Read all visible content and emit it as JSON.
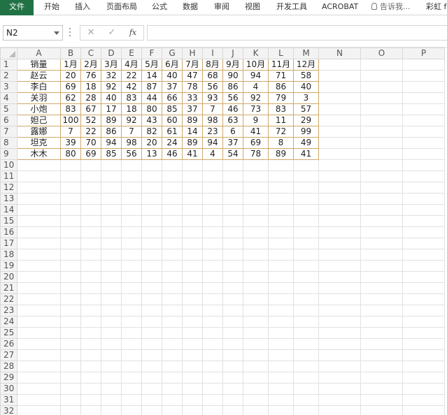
{
  "ribbon": {
    "tabs": [
      "文件",
      "开始",
      "插入",
      "页面布局",
      "公式",
      "数据",
      "审阅",
      "视图",
      "开发工具",
      "ACROBAT"
    ],
    "tell_me": "告诉我...",
    "user": "彩虹 f"
  },
  "formula_bar": {
    "name_box": "N2",
    "cancel_symbol": "✕",
    "enter_symbol": "✓",
    "fx_label": "fx",
    "formula": ""
  },
  "sheet": {
    "columns": [
      "A",
      "B",
      "C",
      "D",
      "E",
      "F",
      "G",
      "H",
      "I",
      "J",
      "K",
      "L",
      "M",
      "N",
      "O",
      "P"
    ],
    "row_numbers": [
      "1",
      "2",
      "3",
      "4",
      "5",
      "6",
      "7",
      "8",
      "9",
      "10",
      "11",
      "12",
      "13",
      "14",
      "15",
      "16",
      "17",
      "18",
      "19",
      "20",
      "21",
      "22",
      "23",
      "24",
      "25",
      "26",
      "27",
      "28",
      "29",
      "30",
      "31",
      "32"
    ],
    "header": [
      "销量",
      "1月",
      "2月",
      "3月",
      "4月",
      "5月",
      "6月",
      "7月",
      "8月",
      "9月",
      "10月",
      "11月",
      "12月"
    ],
    "rows": [
      [
        "赵云",
        "20",
        "76",
        "32",
        "22",
        "14",
        "40",
        "47",
        "68",
        "90",
        "94",
        "71",
        "58"
      ],
      [
        "李白",
        "69",
        "18",
        "92",
        "42",
        "87",
        "37",
        "78",
        "56",
        "86",
        "4",
        "86",
        "40"
      ],
      [
        "关羽",
        "62",
        "28",
        "40",
        "83",
        "44",
        "66",
        "33",
        "93",
        "56",
        "92",
        "79",
        "3"
      ],
      [
        "小炮",
        "83",
        "67",
        "17",
        "18",
        "80",
        "85",
        "37",
        "7",
        "46",
        "73",
        "83",
        "57"
      ],
      [
        "妲己",
        "100",
        "52",
        "89",
        "92",
        "43",
        "60",
        "89",
        "98",
        "63",
        "9",
        "11",
        "29"
      ],
      [
        "露娜",
        "7",
        "22",
        "86",
        "7",
        "82",
        "61",
        "14",
        "23",
        "6",
        "41",
        "72",
        "99"
      ],
      [
        "坦克",
        "39",
        "70",
        "94",
        "98",
        "20",
        "24",
        "89",
        "94",
        "37",
        "69",
        "8",
        "49"
      ],
      [
        "木木",
        "80",
        "69",
        "85",
        "56",
        "13",
        "46",
        "41",
        "4",
        "54",
        "78",
        "89",
        "41"
      ]
    ]
  }
}
